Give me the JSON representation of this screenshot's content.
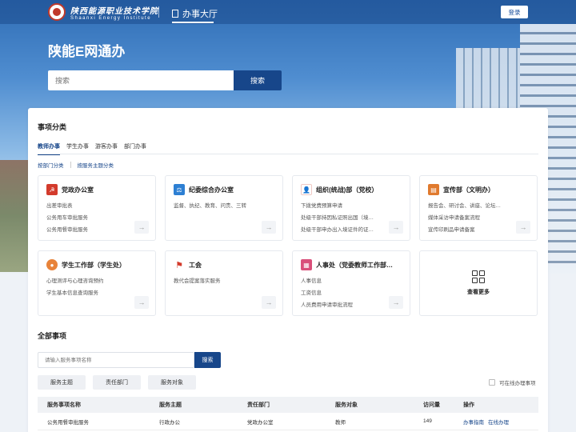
{
  "header": {
    "logo_cn": "陕西能源职业技术学院",
    "logo_en": "Shaanxi Energy Institute",
    "nav_hall": "办事大厅",
    "login": "登录"
  },
  "hero": {
    "title": "陕能E网通办",
    "search_placeholder": "搜索",
    "search_button": "搜索"
  },
  "categories": {
    "title": "事项分类",
    "tabs": [
      "教师办事",
      "学生办事",
      "游客办事",
      "部门办事"
    ],
    "subtabs": [
      "按部门分类",
      "按服务主题分类"
    ],
    "cards": [
      {
        "title": "党政办公室",
        "icon": "party-icon",
        "color": "#d33b2c",
        "items": [
          "出差审批表",
          "公务用车审批服务",
          "公务用餐审批服务"
        ]
      },
      {
        "title": "纪委综合办公室",
        "icon": "scales-icon",
        "color": "#2d7fd3",
        "items": [
          "监督、执纪、教育、问责、三转"
        ]
      },
      {
        "title": "组织(统战)部（党校）",
        "icon": "person-icon",
        "color": "#d33b2c",
        "items": [
          "下拨党费预算申请",
          "处级干部持因私证照出国（境…",
          "处级干部申办出入境证件的证…"
        ]
      },
      {
        "title": "宣传部（文明办）",
        "icon": "megaphone-icon",
        "color": "#e07a2e",
        "items": [
          "报告会、研讨会、讲座、论坛…",
          "媒体采访申请备案流程",
          "宣传印刷品申请备案"
        ]
      },
      {
        "title": "学生工作部（学生处）",
        "icon": "student-icon",
        "color": "#e8833a",
        "items": [
          "心理测评与心理咨询预约",
          "学生基本信息查询服务"
        ]
      },
      {
        "title": "工会",
        "icon": "flag-icon",
        "color": "#d33b2c",
        "items": [
          "教代会提案落实服务"
        ]
      },
      {
        "title": "人事处（党委教师工作部…",
        "icon": "document-icon",
        "color": "#d94f7a",
        "items": [
          "人事信息",
          "工资信息",
          "人员费用申请审批流程"
        ]
      }
    ],
    "more_label": "查看更多"
  },
  "all_items": {
    "title": "全部事项",
    "search_placeholder": "请输入服务事项名称",
    "search_button": "搜索",
    "filters": [
      "服务主题",
      "责任部门",
      "服务对象"
    ],
    "online_only": "可在线办理事项",
    "columns": [
      "服务事项名称",
      "服务主题",
      "责任部门",
      "服务对象",
      "访问量",
      "操作"
    ],
    "rows": [
      {
        "name": "公务用餐审批服务",
        "theme": "行政办公",
        "dept": "党政办公室",
        "target": "教师",
        "visits": "149",
        "guide": "办事指南",
        "online": "在线办理"
      }
    ]
  }
}
